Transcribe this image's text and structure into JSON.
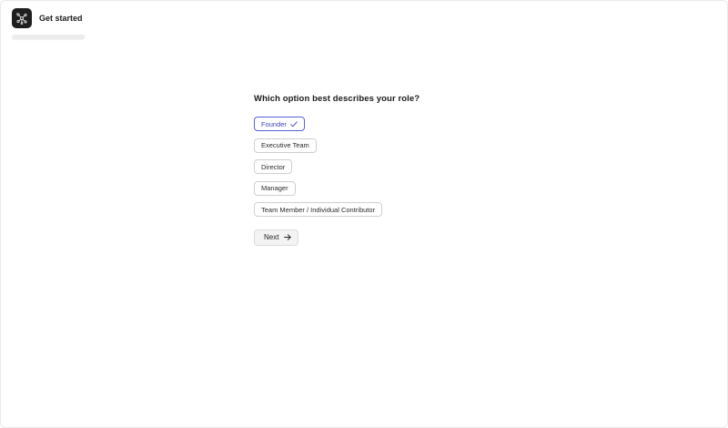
{
  "header": {
    "title": "Get started",
    "logo_icon": "node-graph-icon",
    "progress_fraction": 0.0
  },
  "question": {
    "text": "Which option best describes your role?"
  },
  "options": [
    {
      "label": "Founder",
      "selected": true
    },
    {
      "label": "Executive Team",
      "selected": false
    },
    {
      "label": "Director",
      "selected": false
    },
    {
      "label": "Manager",
      "selected": false
    },
    {
      "label": "Team Member / Individual Contributor",
      "selected": false
    }
  ],
  "next_button": {
    "label": "Next",
    "icon": "arrow-right-icon"
  },
  "colors": {
    "accent": "#5a5fd8",
    "logo_bg": "#1f1f1f"
  }
}
